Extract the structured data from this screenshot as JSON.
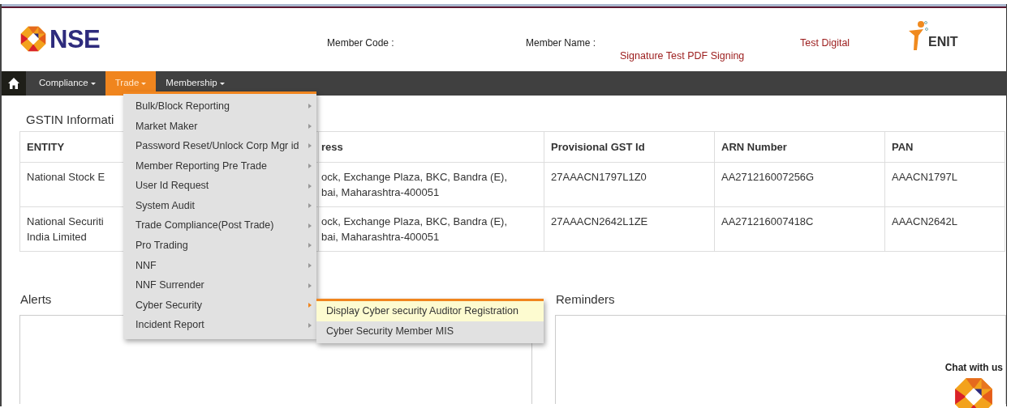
{
  "header": {
    "logo_text": "NSE",
    "member_code_label": "Member Code :",
    "member_name_label": "Member Name :",
    "member_name_value_1": "Test Digital",
    "member_name_value_2": "Signature Test PDF Signing",
    "partner_logo_text": "ENIT"
  },
  "nav": {
    "items": [
      {
        "label": "Compliance",
        "selected": false
      },
      {
        "label": "Trade",
        "selected": true
      },
      {
        "label": "Membership",
        "selected": false
      }
    ]
  },
  "gstin": {
    "title": "GSTIN Informati",
    "columns": [
      "ENTITY",
      "ress",
      "Provisional GST Id",
      "ARN Number",
      "PAN"
    ],
    "rows": [
      [
        "National Stock E",
        "ock, Exchange Plaza, BKC, Bandra (E),\nbai, Maharashtra-400051",
        "27AAACN1797L1Z0",
        "AA271216007256G",
        "AAACN1797L"
      ],
      [
        "National Securiti\nIndia Limited",
        "ock, Exchange Plaza, BKC, Bandra (E),\nbai, Maharashtra-400051",
        "27AAACN2642L1ZE",
        "AA271216007418C",
        "AAACN2642L"
      ]
    ]
  },
  "trade_menu": {
    "items": [
      {
        "label": "Bulk/Block Reporting",
        "expanded": false
      },
      {
        "label": "Market Maker",
        "expanded": false
      },
      {
        "label": "Password Reset/Unlock Corp Mgr id",
        "expanded": false
      },
      {
        "label": "Member Reporting Pre Trade",
        "expanded": false
      },
      {
        "label": "User Id Request",
        "expanded": false
      },
      {
        "label": "System Audit",
        "expanded": false
      },
      {
        "label": "Trade Compliance(Post Trade)",
        "expanded": false
      },
      {
        "label": "Pro Trading",
        "expanded": false
      },
      {
        "label": "NNF",
        "expanded": false
      },
      {
        "label": "NNF Surrender",
        "expanded": false
      },
      {
        "label": "Cyber Security",
        "expanded": true
      },
      {
        "label": "Incident Report",
        "expanded": false
      }
    ]
  },
  "submenu": {
    "items": [
      {
        "label": "Display Cyber security Auditor Registration",
        "selected": true
      },
      {
        "label": "Cyber Security Member MIS",
        "selected": false
      }
    ]
  },
  "alerts": {
    "title": "Alerts"
  },
  "reminders": {
    "title": "Reminders"
  },
  "chat": {
    "label": "Chat with us"
  }
}
